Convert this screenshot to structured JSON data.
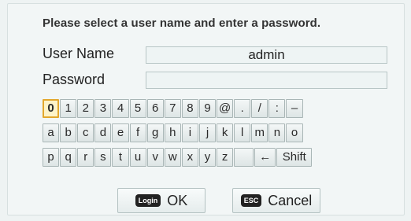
{
  "dialog": {
    "prompt": "Please select a user name and enter a password.",
    "user_label": "User Name",
    "user_value": "admin",
    "password_label": "Password",
    "password_value": ""
  },
  "keyboard": {
    "rows": [
      [
        "0",
        "1",
        "2",
        "3",
        "4",
        "5",
        "6",
        "7",
        "8",
        "9",
        "@",
        ".",
        "/",
        ":",
        "–"
      ],
      [
        "a",
        "b",
        "c",
        "d",
        "e",
        "f",
        "g",
        "h",
        "i",
        "j",
        "k",
        "l",
        "m",
        "n",
        "o"
      ],
      [
        "p",
        "q",
        "r",
        "s",
        "t",
        "u",
        "v",
        "w",
        "x",
        "y",
        "z",
        " ",
        "←",
        "Shift"
      ]
    ],
    "selected_key": "0"
  },
  "actions": {
    "ok_badge": "Login",
    "ok_label": "OK",
    "cancel_badge": "ESC",
    "cancel_label": "Cancel"
  }
}
